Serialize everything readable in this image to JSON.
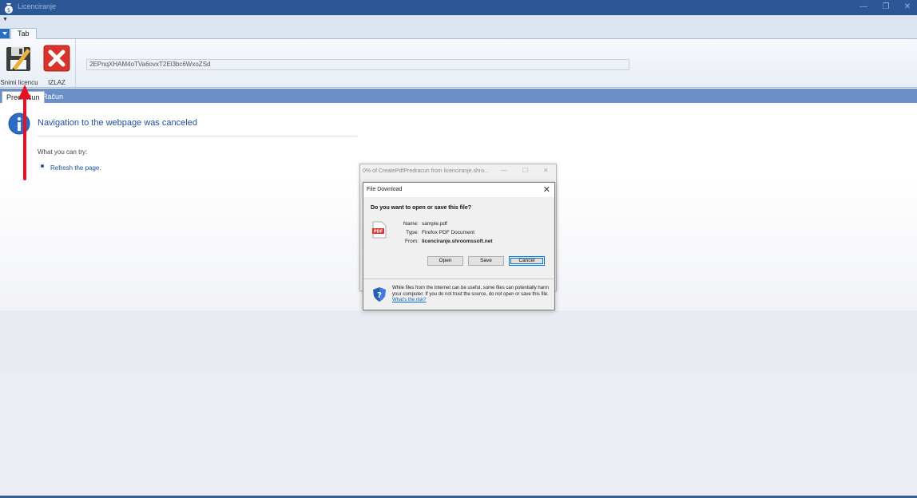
{
  "window": {
    "title": "Licenciranje",
    "minimize_glyph": "—",
    "restore_glyph": "❐",
    "close_glyph": "✕"
  },
  "ribbon": {
    "tab_label": "Tab",
    "save_license_label": "Snimi licencu",
    "exit_label": "IZLAZ",
    "license_key": "2EPnqXHAM4oTVa6ovxT2El3bc6WxoZSd"
  },
  "document_tabs": [
    {
      "label": "Predračun",
      "active": true
    },
    {
      "label": "Račun",
      "active": false
    }
  ],
  "browser_error": {
    "title": "Navigation to the webpage was canceled",
    "try_label": "What you can try:",
    "refresh_link": "Refresh the page."
  },
  "progress_window": {
    "title": "0% of CreatePdfPredracun from licenciranje.shro..."
  },
  "file_download_dialog": {
    "title": "File Download",
    "question": "Do you want to open or save this file?",
    "name_label": "Name:",
    "name_value": "sample.pdf",
    "type_label": "Type:",
    "type_value": "Firefox PDF Document",
    "from_label": "From:",
    "from_value": "licenciranje.shroomssoft.net",
    "open_button": "Open",
    "save_button": "Save",
    "cancel_button": "Cancel",
    "warning_text": "While files from the Internet can be useful, some files can potentially harm your computer. If you do not trust the source, do not open or save this file.",
    "risk_link": "What's the risk?",
    "pdf_badge": "PDF"
  },
  "colors": {
    "titlebar": "#2b5797",
    "ribbon_bg": "#dbe4f1",
    "doc_tab_strip": "#6b8fc7",
    "link_blue": "#1f4e9c",
    "annotation_arrow": "#e81123"
  },
  "icons": {
    "app": "app-bag-icon",
    "save_license": "floppy-pencil-icon",
    "exit": "red-x-icon",
    "info": "info-icon",
    "pdf": "pdf-file-icon",
    "shield": "shield-question-icon"
  }
}
